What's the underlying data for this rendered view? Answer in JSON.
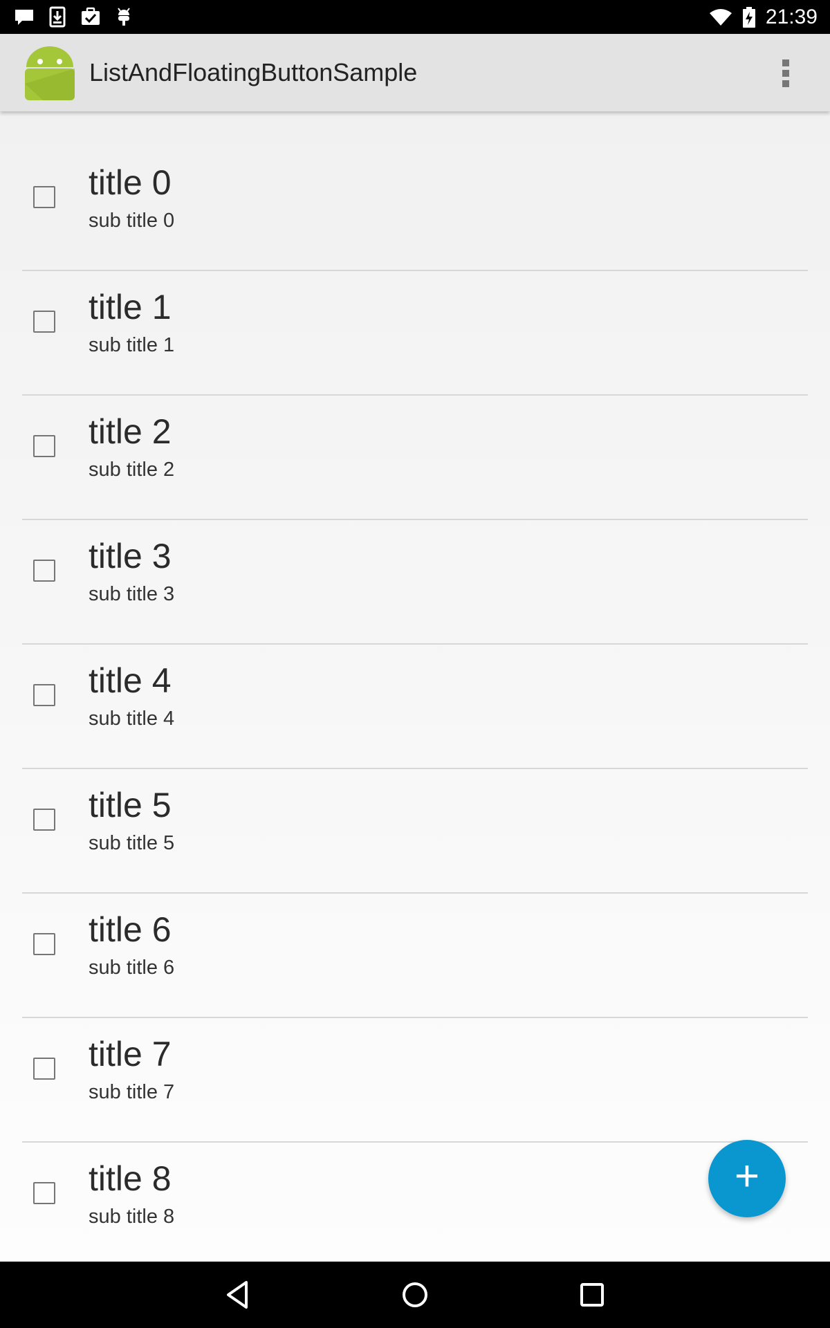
{
  "status_bar": {
    "time": "21:39",
    "left_icons": [
      "message-icon",
      "download-icon",
      "clipboard-check-icon",
      "android-debug-icon"
    ],
    "right_icons": [
      "wifi-icon",
      "battery-charging-icon"
    ]
  },
  "action_bar": {
    "app_icon": "android-launcher-icon",
    "title": "ListAndFloatingButtonSample",
    "overflow_icon": "overflow-menu-icon"
  },
  "list": {
    "items": [
      {
        "title": "title 0",
        "subtitle": "sub title 0",
        "checked": false
      },
      {
        "title": "title 1",
        "subtitle": "sub title 1",
        "checked": false
      },
      {
        "title": "title 2",
        "subtitle": "sub title 2",
        "checked": false
      },
      {
        "title": "title 3",
        "subtitle": "sub title 3",
        "checked": false
      },
      {
        "title": "title 4",
        "subtitle": "sub title 4",
        "checked": false
      },
      {
        "title": "title 5",
        "subtitle": "sub title 5",
        "checked": false
      },
      {
        "title": "title 6",
        "subtitle": "sub title 6",
        "checked": false
      },
      {
        "title": "title 7",
        "subtitle": "sub title 7",
        "checked": false
      },
      {
        "title": "title 8",
        "subtitle": "sub title 8",
        "checked": false
      }
    ]
  },
  "fab": {
    "label": "+",
    "icon": "plus-icon",
    "color": "#0a97cf"
  },
  "nav_bar": {
    "icons": [
      "back-icon",
      "home-icon",
      "recents-icon"
    ]
  }
}
